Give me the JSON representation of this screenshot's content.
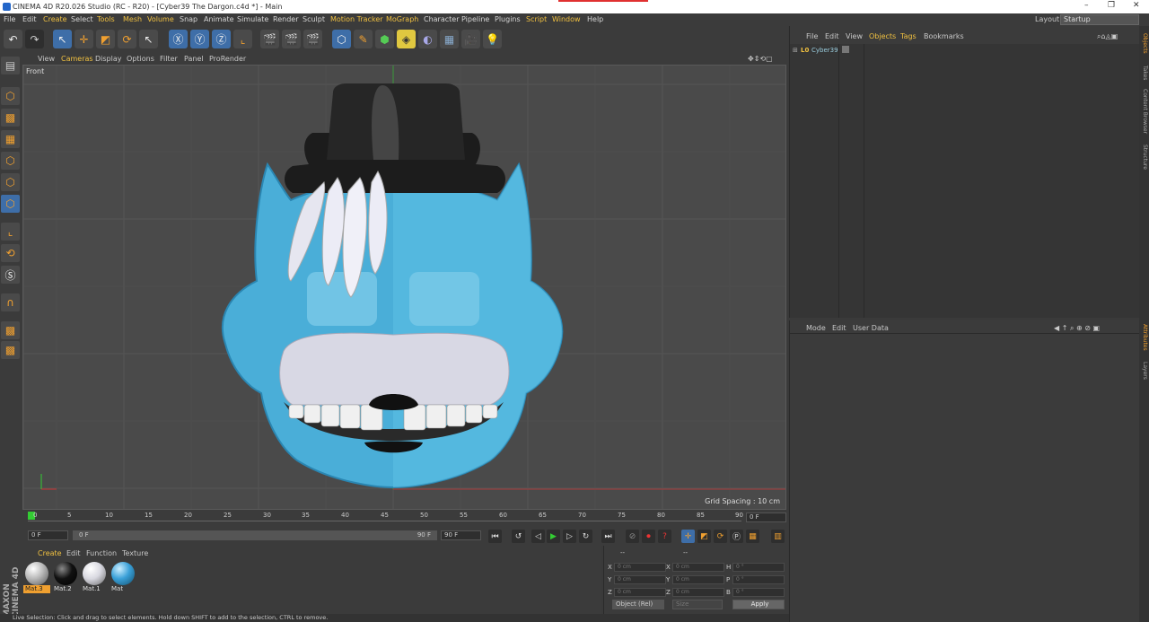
{
  "window": {
    "title": "CINEMA 4D R20.026 Studio (RC - R20) - [Cyber39 The Dargon.c4d *] - Main",
    "minimize": "–",
    "maximize": "❐",
    "close": "✕"
  },
  "menu": {
    "items": [
      "File",
      "Edit",
      "Create",
      "Select",
      "Tools",
      "Mesh",
      "Volume",
      "Snap",
      "Animate",
      "Simulate",
      "Render",
      "Sculpt",
      "Motion Tracker",
      "MoGraph",
      "Character",
      "Pipeline",
      "Plugins",
      "Script",
      "Window",
      "Help"
    ],
    "layout_label": "Layout:",
    "layout_value": "Startup"
  },
  "viewport": {
    "menu": [
      "View",
      "Cameras",
      "Display",
      "Options",
      "Filter",
      "Panel",
      "ProRender"
    ],
    "label": "Front",
    "grid_spacing": "Grid Spacing : 10 cm"
  },
  "timeline": {
    "ticks": [
      "0",
      "5",
      "10",
      "15",
      "20",
      "25",
      "30",
      "35",
      "40",
      "45",
      "50",
      "55",
      "60",
      "65",
      "70",
      "75",
      "80",
      "85",
      "90"
    ],
    "current_frame": "0 F",
    "start": "0 F",
    "range_start": "0 F",
    "range_end": "90 F",
    "end": "90 F"
  },
  "materials": {
    "menu": [
      "Create",
      "Edit",
      "Function",
      "Texture"
    ],
    "items": [
      {
        "name": "Mat.3",
        "color": "#b8b8b8",
        "selected": true
      },
      {
        "name": "Mat.2",
        "color": "#111111",
        "selected": false
      },
      {
        "name": "Mat.1",
        "color": "#d8d8e0",
        "selected": false
      },
      {
        "name": "Mat",
        "color": "#3aa0d8",
        "selected": false
      }
    ]
  },
  "coords": {
    "header": "--",
    "header2": "--",
    "rows": [
      {
        "a": "X",
        "av": "0 cm",
        "b": "X",
        "bv": "0 cm",
        "c": "H",
        "cv": "0 °"
      },
      {
        "a": "Y",
        "av": "0 cm",
        "b": "Y",
        "bv": "0 cm",
        "c": "P",
        "cv": "0 °"
      },
      {
        "a": "Z",
        "av": "0 cm",
        "b": "Z",
        "bv": "0 cm",
        "c": "B",
        "cv": "0 °"
      }
    ],
    "mode": "Object (Rel)",
    "size": "Size",
    "apply": "Apply"
  },
  "objects": {
    "menu": [
      "File",
      "Edit",
      "View",
      "Objects",
      "Tags",
      "Bookmarks"
    ],
    "tree": [
      {
        "name": "Cyber39",
        "icon": "L0"
      }
    ]
  },
  "attributes": {
    "menu": [
      "Mode",
      "Edit",
      "User Data"
    ]
  },
  "sidetabs": [
    "Objects",
    "Takes",
    "Content Browser",
    "Structure"
  ],
  "sidetabs2": [
    "Attributes",
    "Layers"
  ],
  "status": "Live Selection: Click and drag to select elements. Hold down SHIFT to add to the selection, CTRL to remove."
}
